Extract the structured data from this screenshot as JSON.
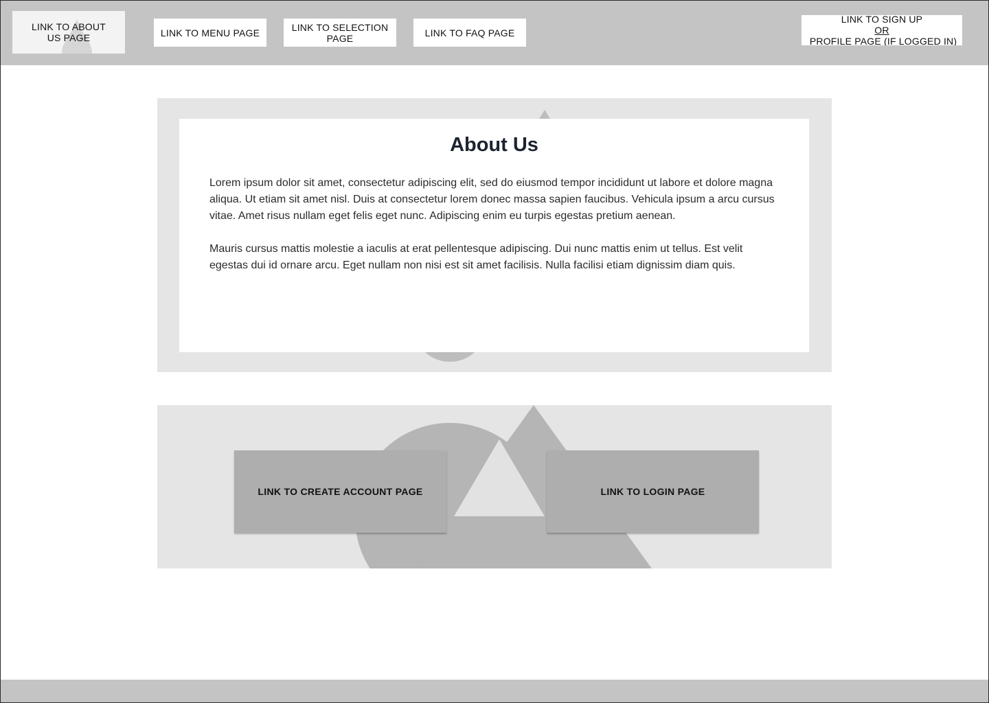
{
  "header": {
    "nav": {
      "about_label": "LINK TO ABOUT\nUS PAGE",
      "menu_label": "LINK TO MENU PAGE",
      "selection_label": "LINK TO SELECTION\nPAGE",
      "faq_label": "LINK TO FAQ PAGE",
      "signup_line1": "LINK TO SIGN UP",
      "signup_or": "OR",
      "signup_line2_rest": " PROFILE PAGE (IF LOGGED IN)"
    },
    "background_color": "#c4c4c4",
    "about_icon": "water-drop-icon"
  },
  "about": {
    "title": "About Us",
    "paragraphs": [
      "Lorem ipsum dolor sit amet, consectetur adipiscing elit, sed do eiusmod tempor incididunt ut labore et dolore magna aliqua. Ut etiam sit amet nisl. Duis at consectetur lorem donec massa sapien faucibus. Vehicula ipsum a arcu cursus vitae. Amet risus nullam eget felis eget nunc. Adipiscing enim eu turpis egestas pretium aenean.",
      "Mauris cursus mattis molestie a iaculis at erat pellentesque adipiscing. Dui nunc mattis enim ut tellus. Est velit egestas dui id ornare arcu. Eget nullam non nisi est sit amet facilisis. Nulla facilisi etiam dignissim diam quis."
    ],
    "background_color": "#e5e5e5"
  },
  "cta": {
    "create_account_label": "LINK TO CREATE ACCOUNT PAGE",
    "login_label": "LINK TO LOGIN PAGE",
    "button_color": "#aeaeae",
    "background_shape": "triangle-circle-placeholder"
  },
  "footer": {
    "background_color": "#c4c4c4"
  }
}
